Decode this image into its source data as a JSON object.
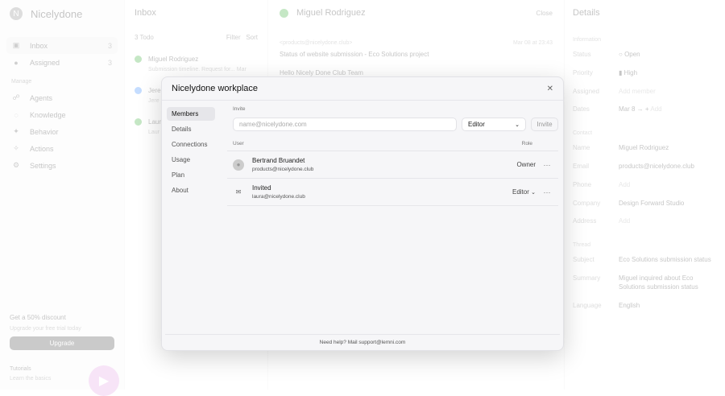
{
  "sidebar": {
    "brand": "Nicelydone",
    "items": [
      {
        "label": "Inbox",
        "count": "3"
      },
      {
        "label": "Assigned",
        "count": "3"
      }
    ],
    "section": "Manage",
    "manage": [
      {
        "label": "Agents"
      },
      {
        "label": "Knowledge"
      },
      {
        "label": "Behavior"
      },
      {
        "label": "Actions"
      },
      {
        "label": "Settings"
      }
    ],
    "promo": {
      "title": "Get a 50% discount",
      "subtitle": "Upgrade your free trial today",
      "button": "Upgrade"
    },
    "tutorials": {
      "title": "Tutorials",
      "subtitle": "Learn the basics"
    }
  },
  "inbox": {
    "title": "Inbox",
    "filter_todo": "3 Todo",
    "filter": "Filter",
    "sort": "Sort",
    "items": [
      {
        "name": "Miguel Rodriguez",
        "preview": "Submission timeline. Request for...",
        "date": "Mar"
      },
      {
        "name": "Jere",
        "preview": "Jere"
      },
      {
        "name": "Laur",
        "preview": "Laur"
      }
    ]
  },
  "thread": {
    "contact": "Miguel Rodriguez",
    "close": "Close",
    "from": "<products@nicelydone.club>",
    "date": "Mar 08 at 23:43",
    "subject": "Status of website submission - Eco Solutions project",
    "greeting": "Hello Nicely Done Club Team"
  },
  "details": {
    "title": "Details",
    "information": "Information",
    "status_label": "Status",
    "status": "Open",
    "priority_label": "Priority",
    "priority": "High",
    "assigned_label": "Assigned",
    "assigned": "Add member",
    "dates_label": "Dates",
    "date": "Mar 8",
    "date_add": "Add",
    "contact": "Contact",
    "name_label": "Name",
    "name": "Miguel Rodriguez",
    "email_label": "Email",
    "email": "products@nicelydone.club",
    "phone_label": "Phone",
    "phone": "Add",
    "company_label": "Company",
    "company": "Design Forward Studio",
    "address_label": "Address",
    "address": "Add",
    "thread": "Thread",
    "subject_label": "Subject",
    "subject": "Eco Solutions submission status",
    "summary_label": "Summary",
    "summary": "Miguel inquired about Eco Solutions submission status",
    "language_label": "Language",
    "language": "English"
  },
  "modal": {
    "title": "Nicelydone workplace",
    "nav": [
      "Members",
      "Details",
      "Connections",
      "Usage",
      "Plan",
      "About"
    ],
    "invite_label": "Invite",
    "invite_placeholder": "name@nicelydone.com",
    "role_select": "Editor",
    "invite_button": "Invite",
    "col_user": "User",
    "col_role": "Role",
    "members": [
      {
        "name": "Bertrand Bruandet",
        "email": "products@nicelydone.club",
        "role": "Owner"
      },
      {
        "name": "Invited",
        "email": "laura@nicelydone.club",
        "role": "Editor"
      }
    ],
    "footer": "Need help? Mail support@lemni.com"
  }
}
